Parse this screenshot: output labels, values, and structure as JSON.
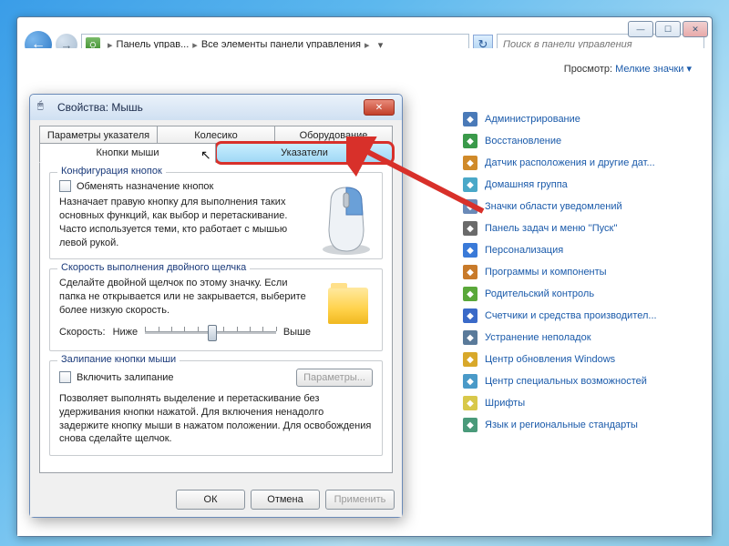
{
  "explorer": {
    "breadcrumb": {
      "item1": "Панель управ...",
      "item2": "Все элементы панели управления"
    },
    "search_placeholder": "Поиск в панели управления",
    "view_label": "Просмотр:",
    "view_value": "Мелкие значки",
    "items": [
      {
        "label": "Администрирование",
        "color": "#4a7ab8"
      },
      {
        "label": "Восстановление",
        "color": "#3a9a4a"
      },
      {
        "label": "Датчик расположения и другие дат...",
        "color": "#d08a2a"
      },
      {
        "label": "Домашняя группа",
        "color": "#4aa8c8"
      },
      {
        "label": "Значки области уведомлений",
        "color": "#6a8ab8"
      },
      {
        "label": "Панель задач и меню ''Пуск''",
        "color": "#6a6a6a"
      },
      {
        "label": "Персонализация",
        "color": "#3a7ad8"
      },
      {
        "label": "Программы и компоненты",
        "color": "#c87a2a"
      },
      {
        "label": "Родительский контроль",
        "color": "#5aa83a"
      },
      {
        "label": "Счетчики и средства производител...",
        "color": "#3a6ac8"
      },
      {
        "label": "Устранение неполадок",
        "color": "#5a7a9a"
      },
      {
        "label": "Центр обновления Windows",
        "color": "#d8a82a"
      },
      {
        "label": "Центр специальных возможностей",
        "color": "#4a9ac8"
      },
      {
        "label": "Шрифты",
        "color": "#d8c84a"
      },
      {
        "label": "Язык и региональные стандарты",
        "color": "#4a9a7a"
      }
    ]
  },
  "dialog": {
    "title": "Свойства: Мышь",
    "tabs_back": [
      "Параметры указателя",
      "Колесико",
      "Оборудование"
    ],
    "tabs_front": [
      "Кнопки мыши",
      "Указатели"
    ],
    "group1": {
      "legend": "Конфигурация кнопок",
      "check": "Обменять назначение кнопок",
      "desc": "Назначает правую кнопку для выполнения таких основных функций, как выбор и перетаскивание. Часто используется теми, кто работает с мышью левой рукой."
    },
    "group2": {
      "legend": "Скорость выполнения двойного щелчка",
      "desc": "Сделайте двойной щелчок по этому значку. Если папка не открывается или не закрывается, выберите более низкую скорость.",
      "speed_label": "Скорость:",
      "low": "Ниже",
      "high": "Выше"
    },
    "group3": {
      "legend": "Залипание кнопки мыши",
      "check": "Включить залипание",
      "params": "Параметры...",
      "desc": "Позволяет выполнять выделение и перетаскивание без удерживания кнопки нажатой. Для включения ненадолго задержите кнопку мыши в нажатом положении. Для освобождения снова сделайте щелчок."
    },
    "buttons": {
      "ok": "ОК",
      "cancel": "Отмена",
      "apply": "Применить"
    }
  }
}
